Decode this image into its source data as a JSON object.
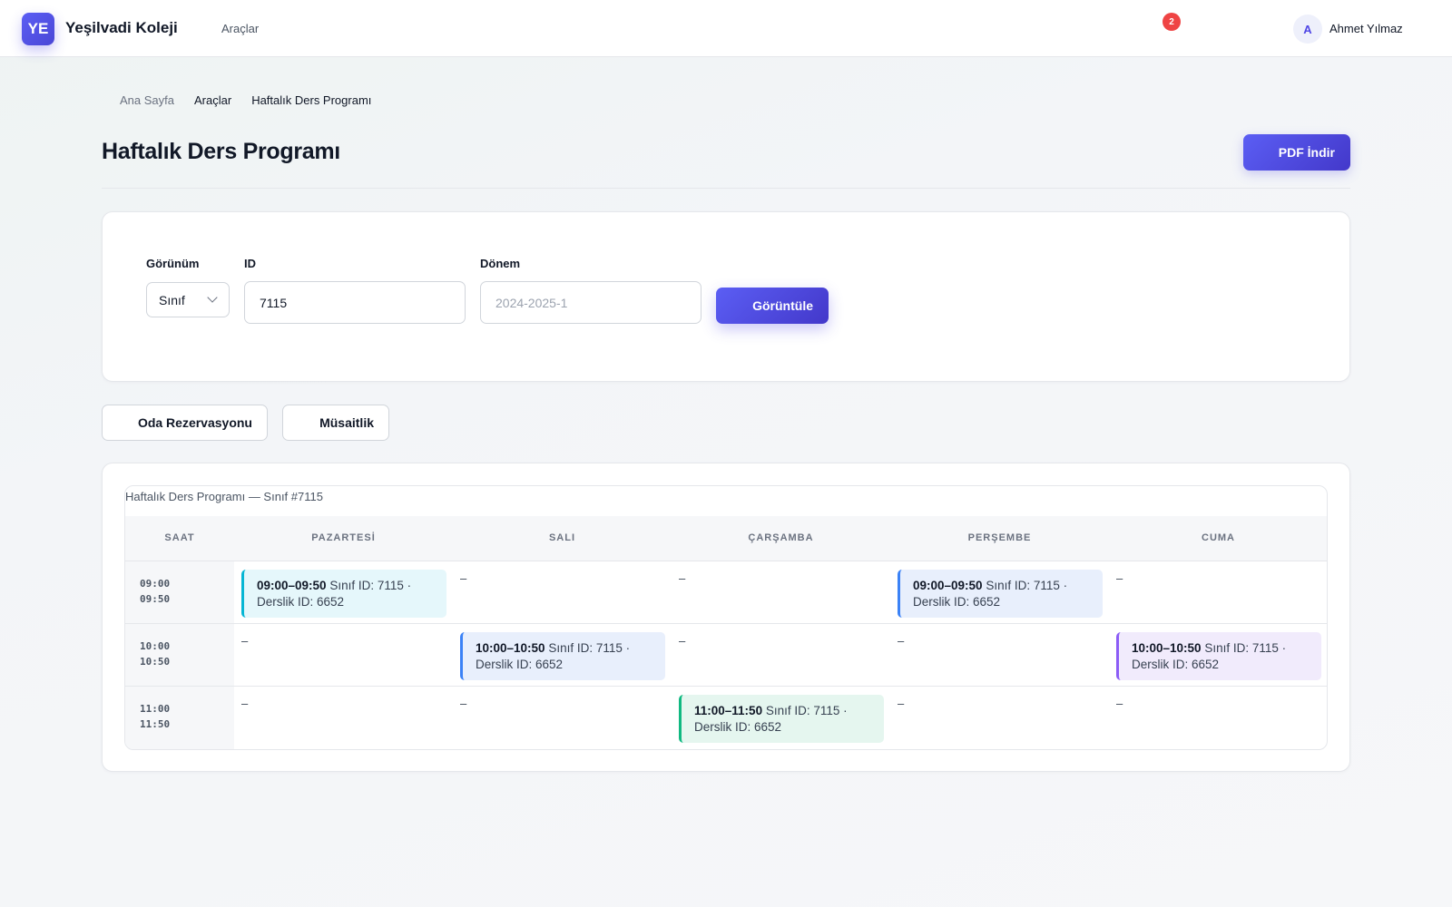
{
  "brand": {
    "initials": "YE",
    "name": "Yeşilvadi Koleji"
  },
  "nav": {
    "tools": "Araçlar"
  },
  "notifications": {
    "count": "2"
  },
  "user": {
    "initial": "A",
    "name": "Ahmet Yılmaz"
  },
  "breadcrumb": [
    "Ana Sayfa",
    "Araçlar",
    "Haftalık Ders Programı"
  ],
  "page": {
    "title": "Haftalık Ders Programı",
    "pdf_button": "PDF İndir"
  },
  "filters": {
    "view_label": "Görünüm",
    "view_value": "Sınıf",
    "id_label": "ID",
    "id_value": "7115",
    "term_label": "Dönem",
    "term_placeholder": "2024-2025-1",
    "submit": "Görüntüle"
  },
  "actions": {
    "room_booking": "Oda Rezervasyonu",
    "availability": "Müsaitlik"
  },
  "schedule": {
    "caption": "Haftalık Ders Programı — Sınıf #7115",
    "headers": [
      "SAAT",
      "PAZARTESİ",
      "SALI",
      "ÇARŞAMBA",
      "PERŞEMBE",
      "CUMA"
    ],
    "empty": "–",
    "rows": [
      {
        "start": "09:00",
        "end": "09:50"
      },
      {
        "start": "10:00",
        "end": "10:50"
      },
      {
        "start": "11:00",
        "end": "11:50"
      }
    ],
    "events": [
      {
        "time": "09:00–09:50",
        "detail": "Sınıf ID: 7115 · Derslik ID: 6652",
        "color": "#06b6d4"
      },
      {
        "time": "09:00–09:50",
        "detail": "Sınıf ID: 7115 · Derslik ID: 6652",
        "color": "#3b82f6"
      },
      {
        "time": "10:00–10:50",
        "detail": "Sınıf ID: 7115 · Derslik ID: 6652",
        "color": "#3b82f6"
      },
      {
        "time": "10:00–10:50",
        "detail": "Sınıf ID: 7115 · Derslik ID: 6652",
        "color": "#8b5cf6"
      },
      {
        "time": "11:00–11:50",
        "detail": "Sınıf ID: 7115 · Derslik ID: 6652",
        "color": "#10b981"
      }
    ]
  },
  "colors": {
    "accent": "#4f46e5",
    "badge": "#ef4444"
  }
}
